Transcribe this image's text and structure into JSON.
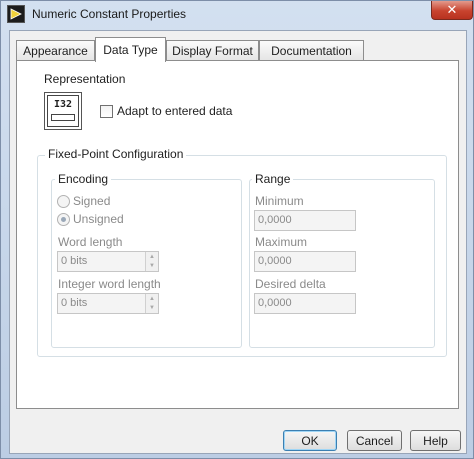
{
  "window": {
    "title": "Numeric Constant Properties",
    "close_label": "✕"
  },
  "tabs": [
    {
      "label": "Appearance",
      "active": false
    },
    {
      "label": "Data Type",
      "active": true
    },
    {
      "label": "Display Format",
      "active": false
    },
    {
      "label": "Documentation",
      "active": false
    }
  ],
  "representation": {
    "label": "Representation",
    "icon_text": "I32",
    "adapt_label": "Adapt to entered data",
    "adapt_checked": false
  },
  "fixed_point": {
    "title": "Fixed-Point Configuration",
    "encoding": {
      "title": "Encoding",
      "signed_label": "Signed",
      "unsigned_label": "Unsigned",
      "selected": "Unsigned",
      "word_length_label": "Word length",
      "word_length_value": "0 bits",
      "integer_word_length_label": "Integer word length",
      "integer_word_length_value": "0 bits"
    },
    "range": {
      "title": "Range",
      "minimum_label": "Minimum",
      "minimum_value": "0,0000",
      "maximum_label": "Maximum",
      "maximum_value": "0,0000",
      "delta_label": "Desired delta",
      "delta_value": "0,0000"
    }
  },
  "buttons": {
    "ok": "OK",
    "cancel": "Cancel",
    "help": "Help"
  }
}
